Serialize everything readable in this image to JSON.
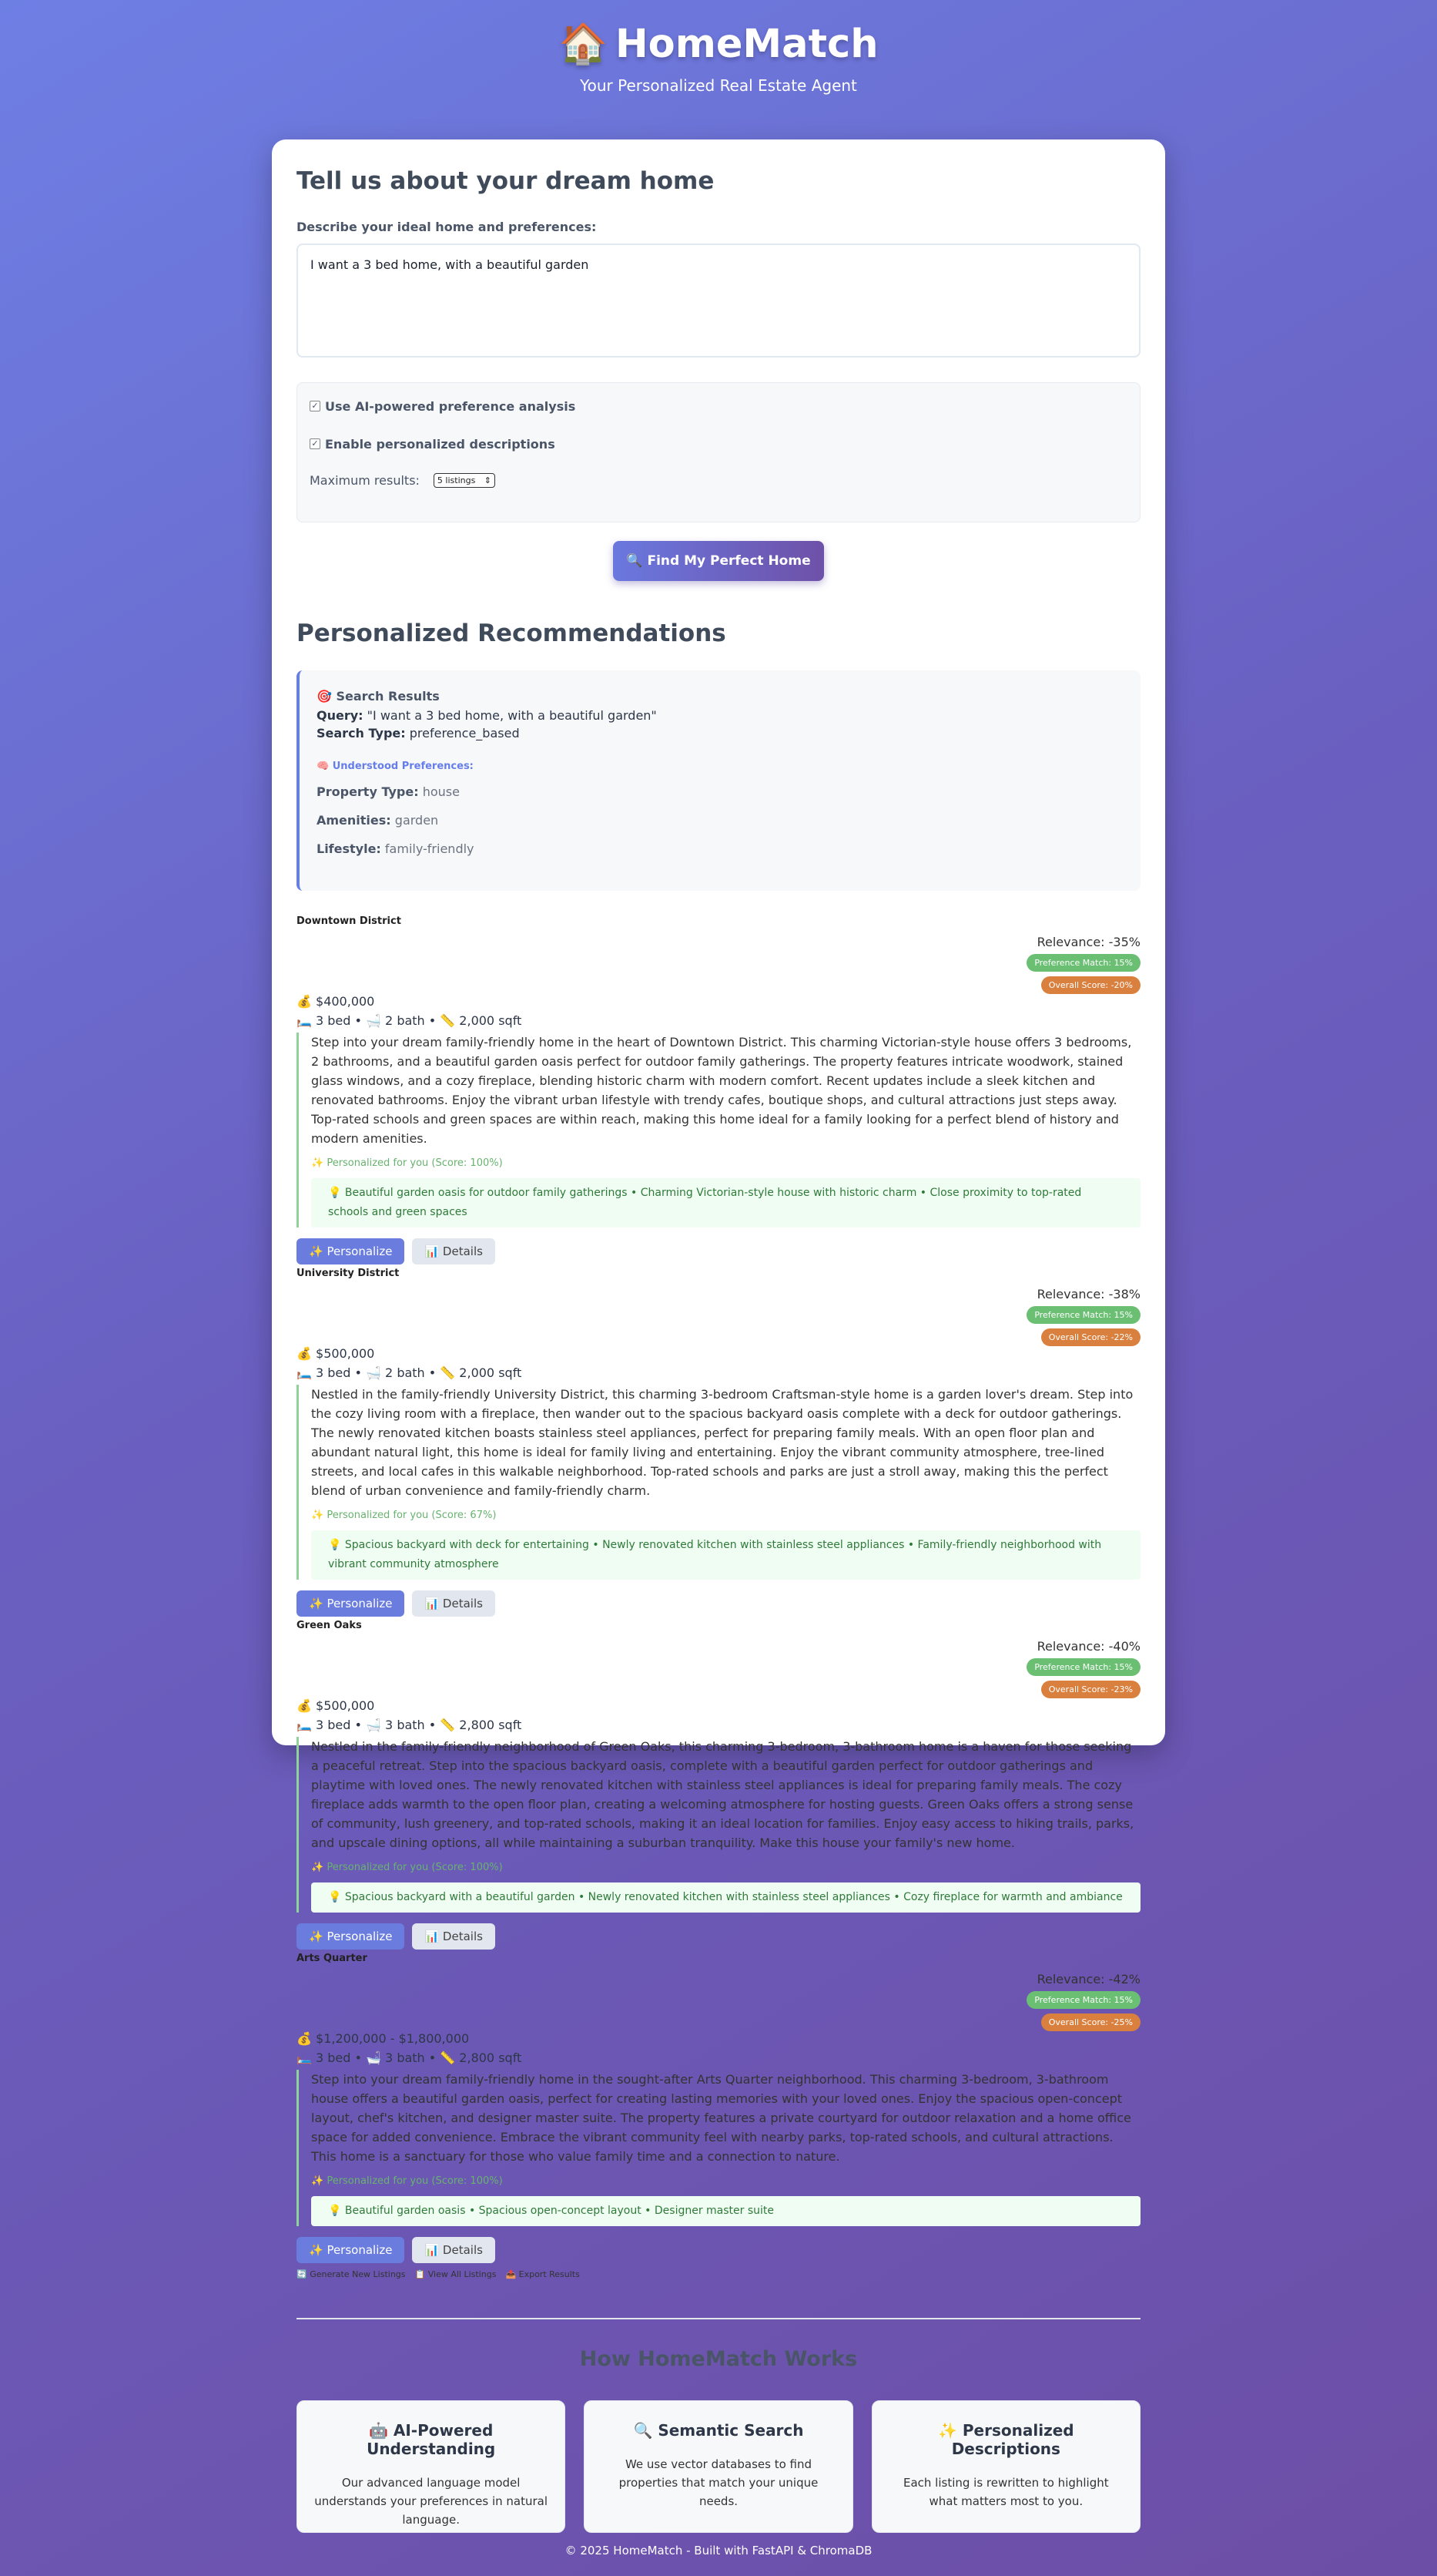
{
  "app": {
    "logo_icon": "🏠",
    "title": "HomeMatch",
    "subtitle": "Your Personalized Real Estate Agent"
  },
  "form": {
    "heading": "Tell us about your dream home",
    "label": "Describe your ideal home and preferences:",
    "query_value": "I want a 3 bed home, with a beautiful garden",
    "option_ai": "Use AI-powered preference analysis",
    "option_personalized": "Enable personalized descriptions",
    "max_results_label": "Maximum results:",
    "max_results_value": "5 listings",
    "submit_label": "🔍 Find My Perfect Home"
  },
  "recommendations": {
    "heading": "Personalized Recommendations",
    "results_title": "🎯 Search Results",
    "query_key": "Query:",
    "query_value": "\"I want a 3 bed home, with a beautiful garden\"",
    "search_type_key": "Search Type:",
    "search_type_value": "preference_based",
    "understood_title": "🧠 Understood Preferences:",
    "property_type_key": "Property Type:",
    "property_type_value": "house",
    "amenities_key": "Amenities:",
    "amenities_value": "garden",
    "lifestyle_key": "Lifestyle:",
    "lifestyle_value": "family-friendly"
  },
  "listings": [
    {
      "name": "Downtown District",
      "relevance": "Relevance: -35%",
      "preference_match": "Preference Match: 15%",
      "overall_score": "Overall Score: -20%",
      "price": "💰 $400,000",
      "specs": "🛏️ 3 bed • 🛁 2 bath • 📏 2,000 sqft",
      "description": "Step into your dream family-friendly home in the heart of Downtown District. This charming Victorian-style house offers 3 bedrooms, 2 bathrooms, and a beautiful garden oasis perfect for outdoor family gatherings. The property features intricate woodwork, stained glass windows, and a cozy fireplace, blending historic charm with modern comfort. Recent updates include a sleek kitchen and renovated bathrooms. Enjoy the vibrant urban lifestyle with trendy cafes, boutique shops, and cultural attractions just steps away. Top-rated schools and green spaces are within reach, making this home ideal for a family looking for a perfect blend of history and modern amenities.",
      "personalized": "✨ Personalized for you (Score: 100%)",
      "highlights": "💡 Beautiful garden oasis for outdoor family gatherings • Charming Victorian-style house with historic charm • Close proximity to top-rated schools and green spaces",
      "personalize_label": "✨ Personalize",
      "details_label": "📊 Details"
    },
    {
      "name": "University District",
      "relevance": "Relevance: -38%",
      "preference_match": "Preference Match: 15%",
      "overall_score": "Overall Score: -22%",
      "price": "💰 $500,000",
      "specs": "🛏️ 3 bed • 🛁 2 bath • 📏 2,000 sqft",
      "description": "Nestled in the family-friendly University District, this charming 3-bedroom Craftsman-style home is a garden lover's dream. Step into the cozy living room with a fireplace, then wander out to the spacious backyard oasis complete with a deck for outdoor gatherings. The newly renovated kitchen boasts stainless steel appliances, perfect for preparing family meals. With an open floor plan and abundant natural light, this home is ideal for family living and entertaining. Enjoy the vibrant community atmosphere, tree-lined streets, and local cafes in this walkable neighborhood. Top-rated schools and parks are just a stroll away, making this the perfect blend of urban convenience and family-friendly charm.",
      "personalized": "✨ Personalized for you (Score: 67%)",
      "highlights": "💡 Spacious backyard with deck for entertaining • Newly renovated kitchen with stainless steel appliances • Family-friendly neighborhood with vibrant community atmosphere",
      "personalize_label": "✨ Personalize",
      "details_label": "📊 Details"
    },
    {
      "name": "Green Oaks",
      "relevance": "Relevance: -40%",
      "preference_match": "Preference Match: 15%",
      "overall_score": "Overall Score: -23%",
      "price": "💰 $500,000",
      "specs": "🛏️ 3 bed • 🛁 3 bath • 📏 2,800 sqft",
      "description": "Nestled in the family-friendly neighborhood of Green Oaks, this charming 3-bedroom, 3-bathroom home is a haven for those seeking a peaceful retreat. Step into the spacious backyard oasis, complete with a beautiful garden perfect for outdoor gatherings and playtime with loved ones. The newly renovated kitchen with stainless steel appliances is ideal for preparing family meals. The cozy fireplace adds warmth to the open floor plan, creating a welcoming atmosphere for hosting guests. Green Oaks offers a strong sense of community, lush greenery, and top-rated schools, making it an ideal location for families. Enjoy easy access to hiking trails, parks, and upscale dining options, all while maintaining a suburban tranquility. Make this house your family's new home.",
      "personalized": "✨ Personalized for you (Score: 100%)",
      "highlights": "💡 Spacious backyard with a beautiful garden • Newly renovated kitchen with stainless steel appliances • Cozy fireplace for warmth and ambiance",
      "personalize_label": "✨ Personalize",
      "details_label": "📊 Details"
    },
    {
      "name": "Arts Quarter",
      "relevance": "Relevance: -42%",
      "preference_match": "Preference Match: 15%",
      "overall_score": "Overall Score: -25%",
      "price": "💰 $1,200,000 - $1,800,000",
      "specs": "🛏️ 3 bed • 🛁 3 bath • 📏 2,800 sqft",
      "description": "Step into your dream family-friendly home in the sought-after Arts Quarter neighborhood. This charming 3-bedroom, 3-bathroom house offers a beautiful garden oasis, perfect for creating lasting memories with your loved ones. Enjoy the spacious open-concept layout, chef's kitchen, and designer master suite. The property features a private courtyard for outdoor relaxation and a home office space for added convenience. Embrace the vibrant community feel with nearby parks, top-rated schools, and cultural attractions. This home is a sanctuary for those who value family time and a connection to nature.",
      "personalized": "✨ Personalized for you (Score: 100%)",
      "highlights": "💡 Beautiful garden oasis • Spacious open-concept layout • Designer master suite",
      "personalize_label": "✨ Personalize",
      "details_label": "📊 Details"
    }
  ],
  "footer_links": {
    "generate": "🔄 Generate New Listings",
    "view_all": "📋 View All Listings",
    "export": "📤 Export Results"
  },
  "how_it_works": {
    "heading": "How HomeMatch Works",
    "features": [
      {
        "title": "🤖 AI-Powered Understanding",
        "desc": "Our advanced language model understands your preferences in natural language."
      },
      {
        "title": "🔍 Semantic Search",
        "desc": "We use vector databases to find properties that match your unique needs."
      },
      {
        "title": "✨ Personalized Descriptions",
        "desc": "Each listing is rewritten to highlight what matters most to you."
      }
    ]
  },
  "page_footer": "© 2025 HomeMatch - Built with FastAPI & ChromaDB"
}
